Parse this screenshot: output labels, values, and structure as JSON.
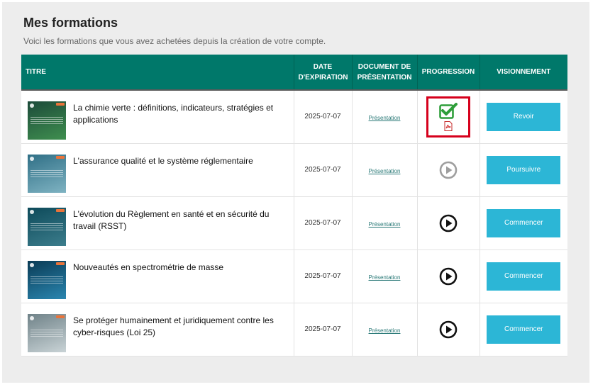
{
  "header": {
    "title": "Mes formations",
    "subtitle": "Voici les formations que vous avez achetées depuis la création de votre compte."
  },
  "table": {
    "columns": {
      "title": "TITRE",
      "expiration": "DATE D'EXPIRATION",
      "document": "DOCUMENT DE PRÉSENTATION",
      "progress": "PROGRESSION",
      "viewing": "VISIONNEMENT"
    },
    "rows": [
      {
        "title": "La chimie verte : définitions, indicateurs, stratégies et applications",
        "date": "2025-07-07",
        "doc_label": "Présentation",
        "progress": "completed",
        "action": "Revoir",
        "thumb_colors": [
          "#1c4a3a",
          "#3f8f4f"
        ]
      },
      {
        "title": "L'assurance qualité et le système réglementaire",
        "date": "2025-07-07",
        "doc_label": "Présentation",
        "progress": "in-progress",
        "action": "Poursuivre",
        "thumb_colors": [
          "#2f6f86",
          "#7fb3c2"
        ]
      },
      {
        "title": "L'évolution du Règlement en santé et en sécurité du travail (RSST)",
        "date": "2025-07-07",
        "doc_label": "Présentation",
        "progress": "not-started",
        "action": "Commencer",
        "thumb_colors": [
          "#0d4a5a",
          "#3c7d8c"
        ]
      },
      {
        "title": "Nouveautés en spectrométrie de masse",
        "date": "2025-07-07",
        "doc_label": "Présentation",
        "progress": "not-started",
        "action": "Commencer",
        "thumb_colors": [
          "#0a3b55",
          "#2a86b0"
        ]
      },
      {
        "title": "Se protéger humainement et juridiquement contre les cyber-risques (Loi 25)",
        "date": "2025-07-07",
        "doc_label": "Présentation",
        "progress": "not-started",
        "action": "Commencer",
        "thumb_colors": [
          "#6f8288",
          "#c9d3d6"
        ]
      }
    ]
  },
  "colors": {
    "header_bg": "#00786a",
    "button_bg": "#2cb6d6",
    "check_green": "#2e9e3a",
    "highlight_red": "#d6001c",
    "play_inactive": "#9e9e9e",
    "play_active": "#111111"
  },
  "icons": {
    "completed": "check-icon",
    "pdf": "pdf-icon",
    "in-progress": "play-circle-icon",
    "not-started": "play-circle-icon"
  }
}
